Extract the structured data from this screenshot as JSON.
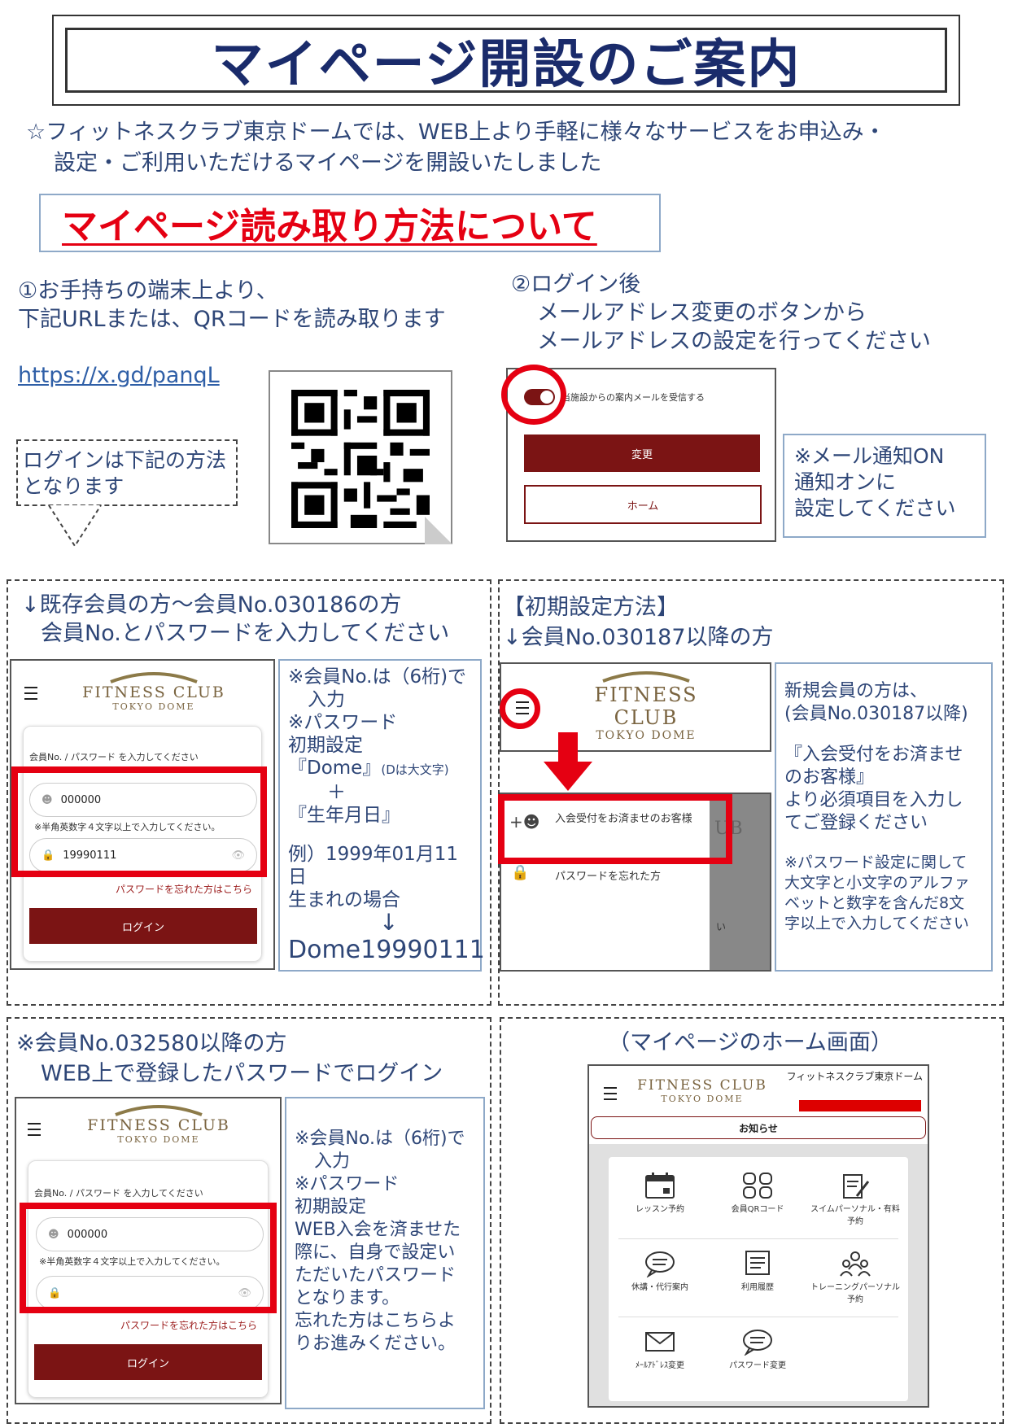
{
  "title": "マイページ開設のご案内",
  "intro": [
    "☆フィットネスクラブ東京ドームでは、WEB上より手軽に様々なサービスをお申込み・",
    "設定・ご利用いただけるマイページを開設いたしました"
  ],
  "subhead": "マイページ読み取り方法について",
  "step1": [
    "①お手持ちの端末上より、",
    "下記URLまたは、QRコードを読み取ります"
  ],
  "url": "https://x.gd/panqL",
  "bubble": [
    "ログインは下記の方法",
    "となります"
  ],
  "step2": [
    "②ログイン後",
    "メールアドレス変更のボタンから",
    "メールアドレスの設定を行ってください"
  ],
  "mail_mock": {
    "toggle_label": "当施設からの案内メールを受信する",
    "change_btn": "変更",
    "home_btn": "ホーム"
  },
  "mail_note": [
    "※メール通知ON",
    "通知オンに",
    "設定してください"
  ],
  "existing": {
    "head": [
      "↓既存会員の方〜会員No.030186の方",
      "会員No.とパスワードを入力してください"
    ],
    "note": [
      "※会員No.は（6桁)で",
      "入力",
      "※パスワード",
      "初期設定",
      "『Dome』",
      "(Dは大文字)",
      "＋",
      "『生年月日』",
      "例）1999年01月11日",
      "生まれの場合",
      "↓",
      "Dome19990111"
    ],
    "form": {
      "label": "会員No. / パスワード を入力してください",
      "member_no": "000000",
      "hint": "※半角英数字４文字以上で入力してください。",
      "password": "19990111",
      "forgot": "パスワードを忘れた方はこちら",
      "login": "ログイン"
    }
  },
  "initial": {
    "head": [
      "【初期設定方法】",
      "↓会員No.030187以降の方"
    ],
    "menu1": "入会受付をお済ませのお客様",
    "menu2": "パスワードを忘れた方",
    "partial1": "UB",
    "partial2": "い",
    "note": [
      "新規会員の方は、",
      "(会員No.030187以降)",
      "『入会受付をお済ませ",
      "のお客様』",
      "より必須項目を入力し",
      "てご登録ください",
      "※パスワード設定に関して",
      "大文字と小文字のアルファ",
      "ベットと数字を含んだ8文",
      "字以上で入力してください"
    ]
  },
  "later": {
    "head": [
      "※会員No.032580以降の方",
      "WEB上で登録したパスワードでログイン"
    ],
    "note": [
      "※会員No.は（6桁)で",
      "入力",
      "※パスワード",
      "初期設定",
      "WEB入会を済ませた",
      "際に、自身で設定い",
      "ただいたパスワード",
      "となります。",
      "忘れた方はこちらよ",
      "りお進みください。"
    ],
    "form": {
      "label": "会員No. / パスワード を入力してください",
      "member_no": "000000",
      "hint": "※半角英数字４文字以上で入力してください。",
      "forgot": "パスワードを忘れた方はこちら",
      "login": "ログイン"
    }
  },
  "home": {
    "head": "（マイページのホーム画面）",
    "club_name": "フィットネスクラブ東京ドーム",
    "notice": "お知らせ",
    "items": [
      "レッスン予約",
      "会員QRコード",
      "スイムパーソナル・有料予約",
      "休講・代行案内",
      "利用履歴",
      "トレーニングパーソナル予約",
      "ﾒｰﾙｱﾄﾞﾚｽ変更",
      "パスワード変更"
    ]
  },
  "logo": {
    "line1": "FITNESS CLUB",
    "line2": "TOKYO DOME"
  }
}
